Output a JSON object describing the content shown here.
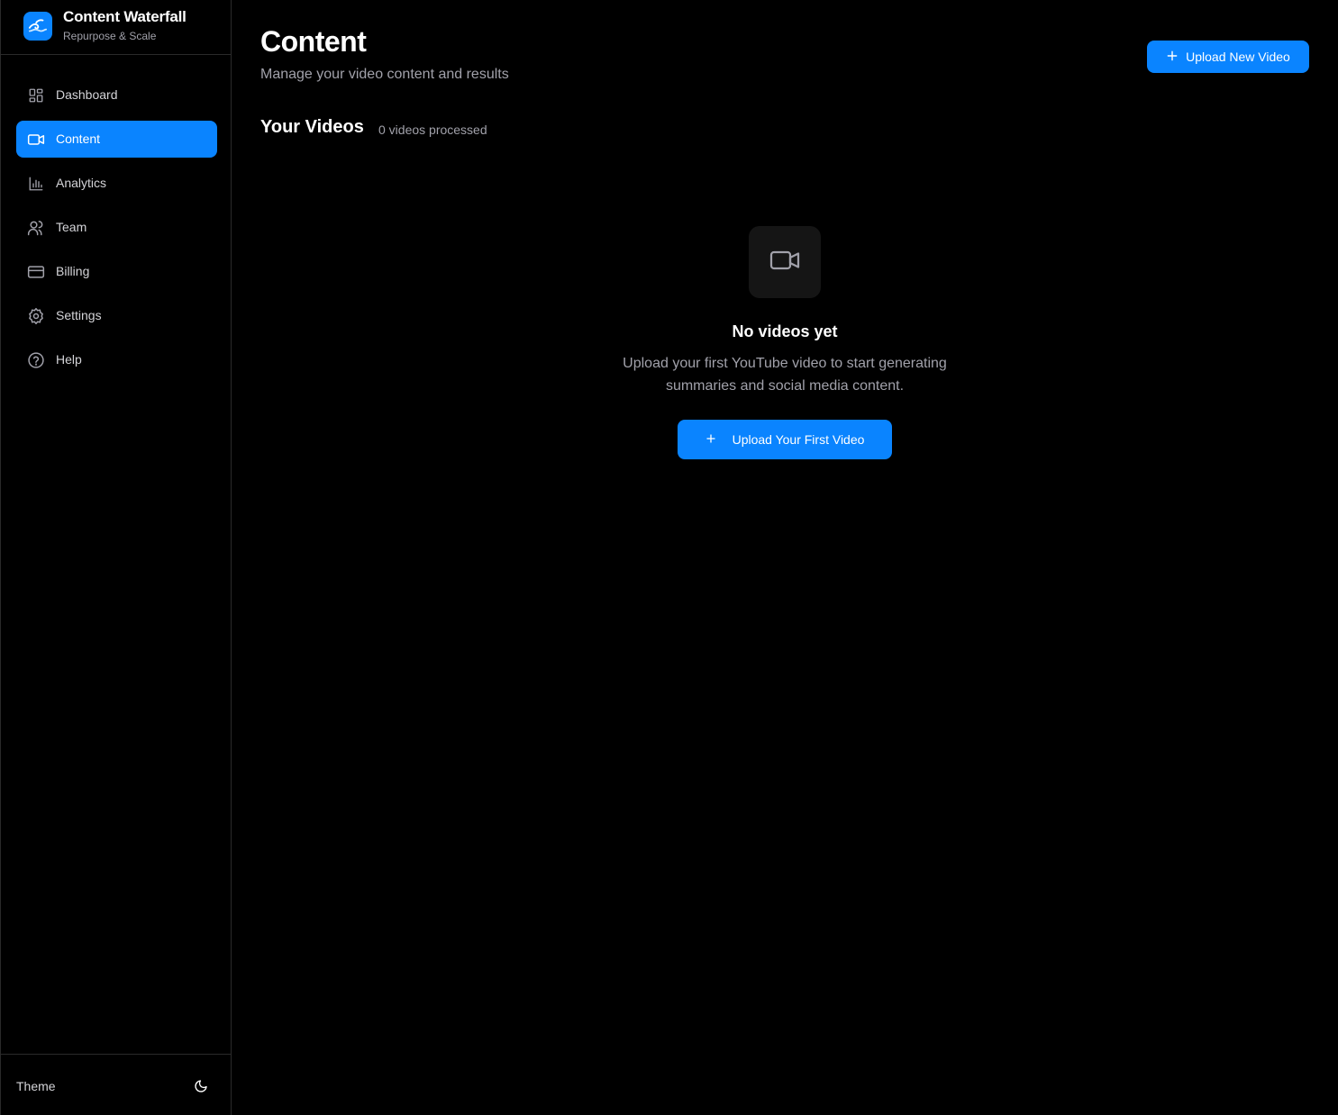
{
  "brand": {
    "logo_icon": "wave-emoji-icon",
    "title": "Content Waterfall",
    "subtitle": "Repurpose & Scale"
  },
  "sidebar": {
    "items": [
      {
        "label": "Dashboard",
        "icon": "dashboard-grid-icon",
        "active": false
      },
      {
        "label": "Content",
        "icon": "video-camera-icon",
        "active": true
      },
      {
        "label": "Analytics",
        "icon": "bar-chart-icon",
        "active": false
      },
      {
        "label": "Team",
        "icon": "users-icon",
        "active": false
      },
      {
        "label": "Billing",
        "icon": "credit-card-icon",
        "active": false
      },
      {
        "label": "Settings",
        "icon": "gear-icon",
        "active": false
      },
      {
        "label": "Help",
        "icon": "help-circle-icon",
        "active": false
      }
    ],
    "footer": {
      "theme_label": "Theme",
      "theme_icon": "moon-icon"
    }
  },
  "header": {
    "title": "Content",
    "subtitle": "Manage your video content and results",
    "upload_button": "Upload New Video"
  },
  "videos": {
    "title": "Your Videos",
    "count_text": "0 videos processed"
  },
  "empty_state": {
    "icon": "video-camera-icon",
    "title": "No videos yet",
    "description": "Upload your first YouTube video to start generating summaries and social media content.",
    "button": "Upload Your First Video"
  },
  "colors": {
    "accent": "#0a84ff",
    "background": "#000000",
    "muted_text": "#a1a1aa",
    "border": "#2a2a2a"
  }
}
